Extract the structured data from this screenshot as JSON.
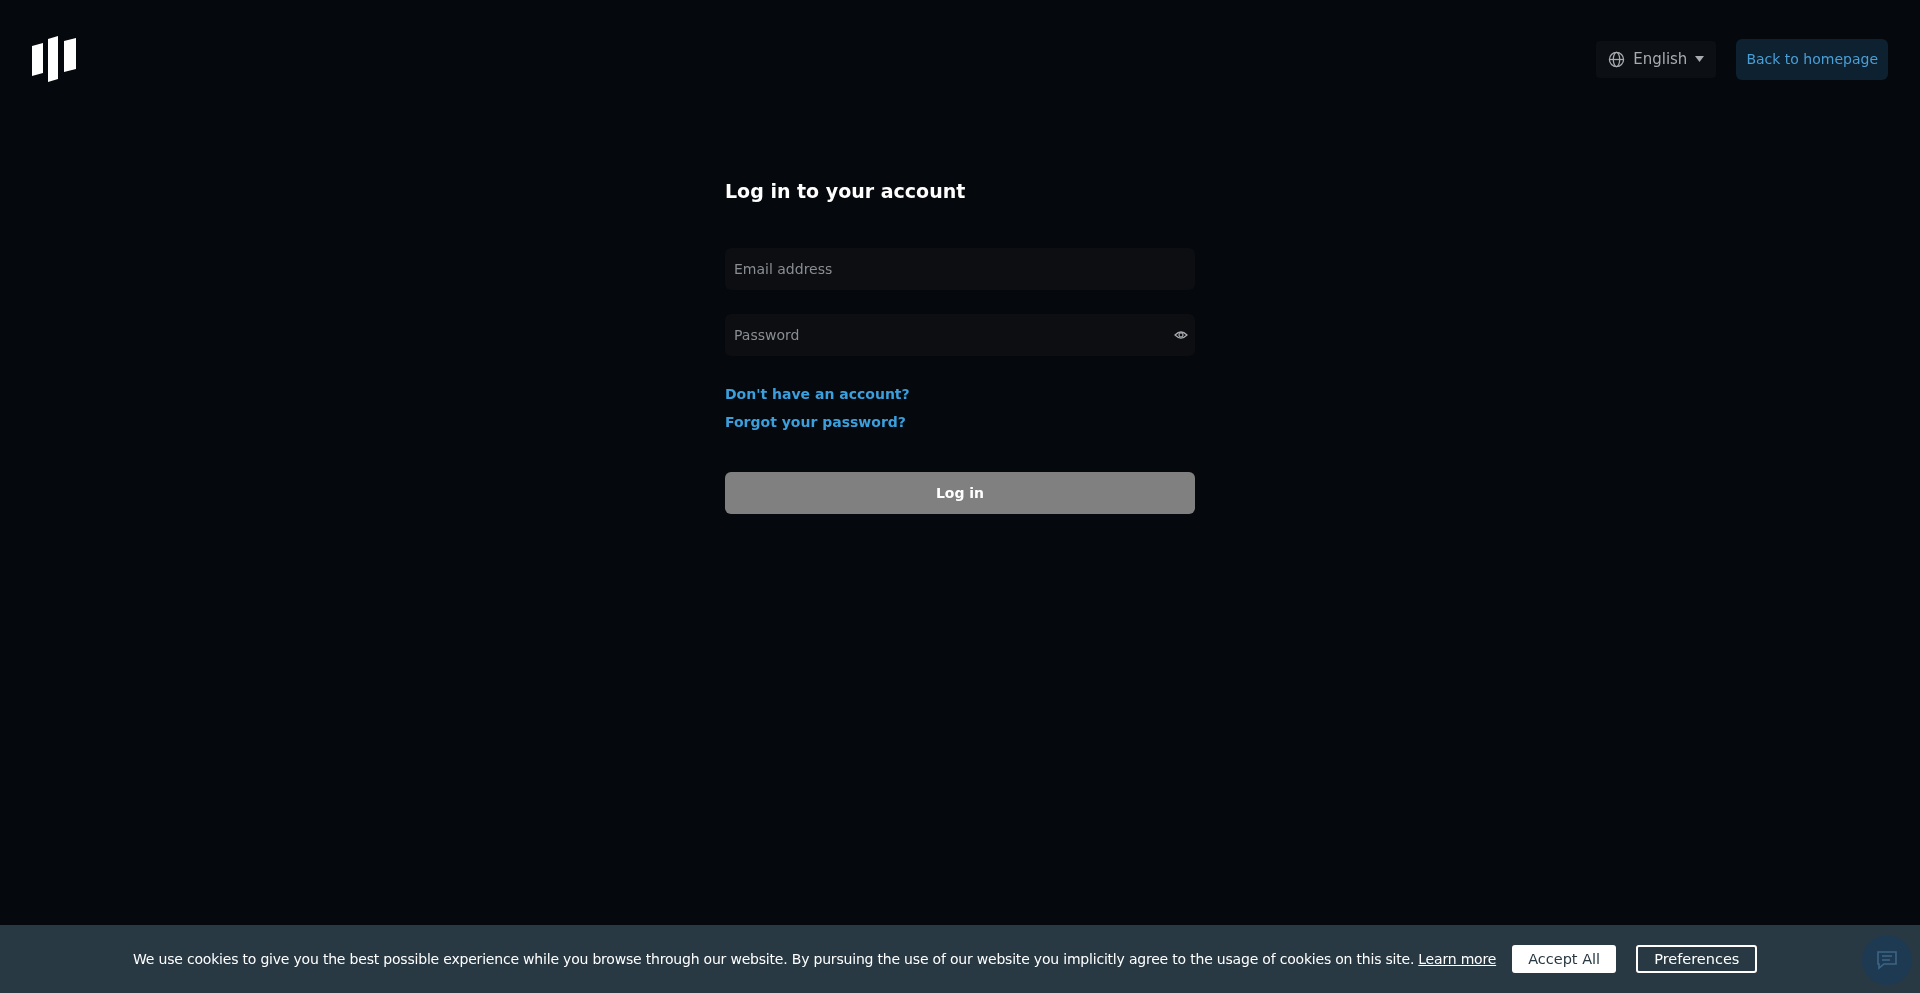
{
  "header": {
    "language": "English",
    "back_link": "Back to homepage"
  },
  "login": {
    "title": "Log in to your account",
    "email": {
      "placeholder": "Email address"
    },
    "password": {
      "placeholder": "Password"
    },
    "links": [
      "Don't have an account?",
      "Forgot your password?"
    ],
    "submit": {
      "label": "Log in",
      "disabled": true
    }
  },
  "cookie_banner": {
    "text": "We use cookies to give you the best possible experience while you browse through our website. By pursuing the use of our website you implicitly agree to the usage of cookies on this site.",
    "link": "Learn more",
    "buttons": [
      {
        "label": "Accept All",
        "kind": "primary"
      },
      {
        "label": "Preferences",
        "kind": "outline"
      }
    ]
  }
}
